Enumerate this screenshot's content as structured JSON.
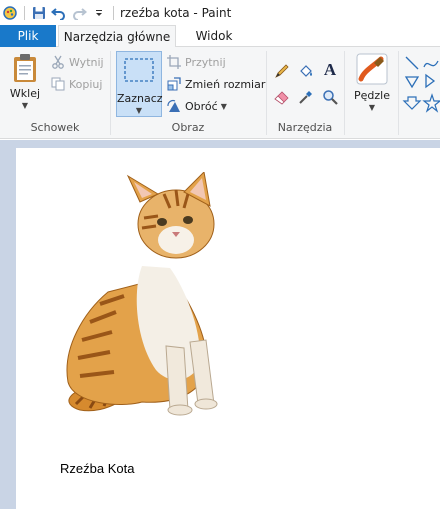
{
  "window": {
    "title": "rzeźba kota - Paint"
  },
  "tabs": [
    {
      "label": "Plik"
    },
    {
      "label": "Narzędzia główne"
    },
    {
      "label": "Widok"
    }
  ],
  "ribbon": {
    "clipboard": {
      "paste_label": "Wklej",
      "cut_label": "Wytnij",
      "copy_label": "Kopiuj",
      "group_label": "Schowek"
    },
    "image": {
      "select_label": "Zaznacz",
      "crop_label": "Przytnij",
      "resize_label": "Zmień rozmiar",
      "rotate_label": "Obróć",
      "group_label": "Obraz"
    },
    "tools": {
      "group_label": "Narzędzia"
    },
    "brushes": {
      "label": "Pędzle"
    }
  },
  "canvas": {
    "caption": "Rzeźba Kota"
  },
  "colors": {
    "accent": "#1979ca",
    "workspace": "#c9d4e5",
    "ribbon": "#f5f6f7"
  }
}
